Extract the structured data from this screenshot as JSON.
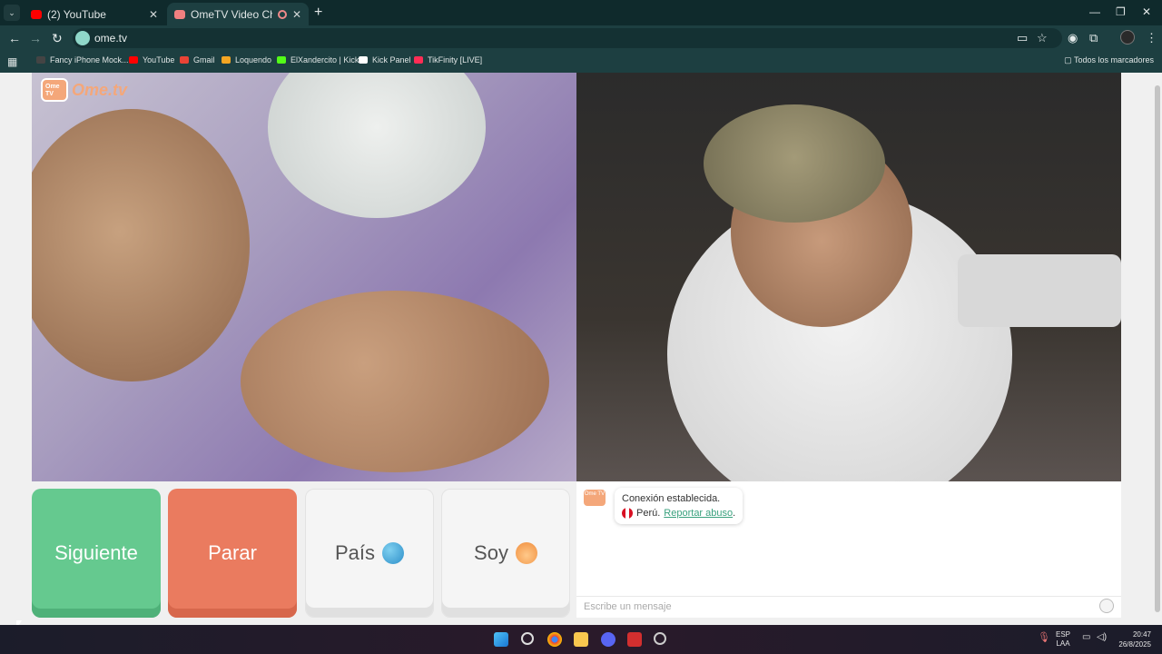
{
  "browser": {
    "tabs": [
      {
        "title": "(2) YouTube",
        "active": false,
        "favicon_color": "#ff0000"
      },
      {
        "title": "OmeTV Video Chat — Ome",
        "active": true,
        "favicon_color": "#f08080"
      }
    ],
    "url": "ome.tv",
    "bookmarks": [
      {
        "label": "Fancy iPhone Mock...",
        "color": "#444444"
      },
      {
        "label": "YouTube",
        "color": "#ff0000"
      },
      {
        "label": "Gmail",
        "color": "#ea4335"
      },
      {
        "label": "Loquendo",
        "color": "#f5a623"
      },
      {
        "label": "ElXandercito | Kick",
        "color": "#53fc18"
      },
      {
        "label": "Kick Panel",
        "color": "#ffffff"
      },
      {
        "label": "TikFinity [LIVE]",
        "color": "#ff2d55"
      }
    ],
    "all_bookmarks": "Todos los marcadores"
  },
  "page": {
    "logo": {
      "tv_text": "Ome TV",
      "brand": "Ome.tv"
    },
    "buttons": {
      "next": "Siguiente",
      "stop": "Parar",
      "country": "País",
      "gender": "Soy"
    },
    "chat": {
      "logo_text": "Ome TV",
      "status": "Conexión establecida.",
      "country": "Perú.",
      "report_link": "Reportar abuso",
      "report_suffix": ".",
      "input_placeholder": "Escribe un mensaje"
    }
  },
  "taskbar": {
    "lang_top": "ESP",
    "lang_bottom": "LAA",
    "time": "20:47",
    "date": "26/8/2025"
  }
}
